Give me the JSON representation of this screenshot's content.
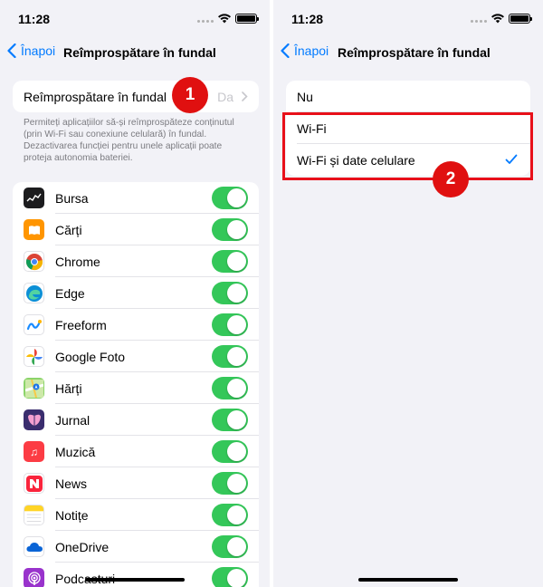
{
  "left": {
    "status": {
      "time": "11:28"
    },
    "nav": {
      "back_label": "Înapoi",
      "title": "Reîmprospătare în fundal"
    },
    "setting": {
      "label": "Reîmprospătare în fundal",
      "value": "Da"
    },
    "footer": "Permiteți aplicațiilor să-și reîmprospăteze conținutul (prin Wi-Fi sau conexiune celulară) în fundal. Dezactivarea funcției pentru unele aplicații poate proteja autonomia bateriei.",
    "badge": "1",
    "apps": [
      {
        "name": "Bursa",
        "icon": "stocks-icon",
        "color": "#1c1c1e",
        "glyph": ""
      },
      {
        "name": "Cărți",
        "icon": "books-icon",
        "color": "#ff9500",
        "glyph": ""
      },
      {
        "name": "Chrome",
        "icon": "chrome-icon",
        "color": "#ffffff",
        "glyph": ""
      },
      {
        "name": "Edge",
        "icon": "edge-icon",
        "color": "#ffffff",
        "glyph": ""
      },
      {
        "name": "Freeform",
        "icon": "freeform-icon",
        "color": "#ffffff",
        "glyph": ""
      },
      {
        "name": "Google Foto",
        "icon": "google-photos-icon",
        "color": "#ffffff",
        "glyph": ""
      },
      {
        "name": "Hărți",
        "icon": "maps-icon",
        "color": "#8bd46a",
        "glyph": ""
      },
      {
        "name": "Jurnal",
        "icon": "journal-icon",
        "color": "#3a2d6e",
        "glyph": ""
      },
      {
        "name": "Muzică",
        "icon": "music-icon",
        "color": "#fc3c44",
        "glyph": "♫"
      },
      {
        "name": "News",
        "icon": "news-icon",
        "color": "#ffffff",
        "glyph": ""
      },
      {
        "name": "Notițe",
        "icon": "notes-icon",
        "color": "#ffffff",
        "glyph": ""
      },
      {
        "name": "OneDrive",
        "icon": "onedrive-icon",
        "color": "#ffffff",
        "glyph": ""
      },
      {
        "name": "Podcasturi",
        "icon": "podcasts-icon",
        "color": "#9933cc",
        "glyph": ""
      }
    ]
  },
  "right": {
    "status": {
      "time": "11:28"
    },
    "nav": {
      "back_label": "Înapoi",
      "title": "Reîmprospătare în fundal"
    },
    "options": [
      {
        "label": "Nu",
        "selected": false
      },
      {
        "label": "Wi-Fi",
        "selected": false
      },
      {
        "label": "Wi-Fi și date celulare",
        "selected": true
      }
    ],
    "badge": "2"
  },
  "colors": {
    "accent": "#007aff",
    "toggle_on": "#34c759",
    "annotation": "#e8101a"
  }
}
